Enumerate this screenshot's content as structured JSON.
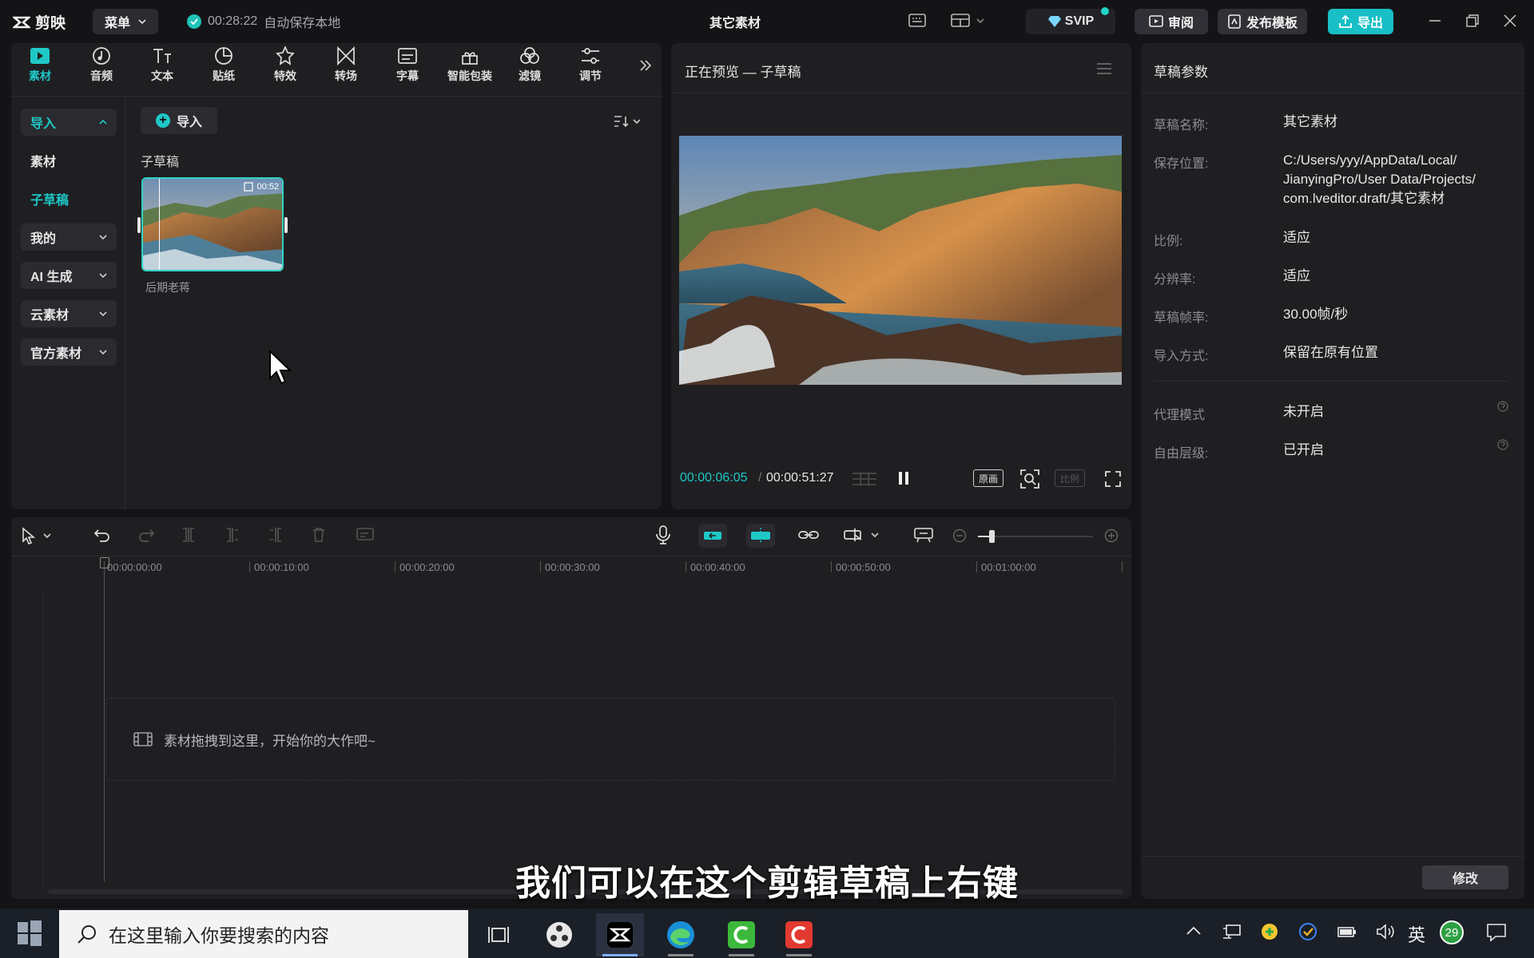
{
  "titlebar": {
    "app_name": "剪映",
    "menu_label": "菜单",
    "autosave_time": "00:28:22",
    "autosave_text": "自动保存本地",
    "project_title": "其它素材",
    "svip_label": "SVIP",
    "review_label": "审阅",
    "publish_template_label": "发布模板",
    "export_label": "导出"
  },
  "toolbar": {
    "tabs": [
      {
        "label": "素材",
        "icon": "media-icon",
        "active": true
      },
      {
        "label": "音频",
        "icon": "audio-icon"
      },
      {
        "label": "文本",
        "icon": "text-icon"
      },
      {
        "label": "贴纸",
        "icon": "sticker-icon"
      },
      {
        "label": "特效",
        "icon": "effects-icon"
      },
      {
        "label": "转场",
        "icon": "transition-icon"
      },
      {
        "label": "字幕",
        "icon": "caption-icon"
      },
      {
        "label": "智能包装",
        "icon": "smart-pack-icon"
      },
      {
        "label": "滤镜",
        "icon": "filter-icon"
      },
      {
        "label": "调节",
        "icon": "adjust-icon"
      }
    ]
  },
  "sidebar": {
    "items": [
      {
        "label": "导入",
        "active": true
      },
      {
        "label": "素材"
      },
      {
        "label": "子草稿",
        "active": true
      },
      {
        "label": "我的"
      },
      {
        "label": "AI 生成"
      },
      {
        "label": "云素材"
      },
      {
        "label": "官方素材"
      }
    ]
  },
  "media": {
    "import_label": "导入",
    "section_title": "子草稿",
    "clip_name": "后期老蒋",
    "clip_duration": "00:52"
  },
  "preview": {
    "title": "正在预览 — 子草稿",
    "current_time": "00:00:06:05",
    "total_time": "00:00:51:27",
    "original_label": "原画",
    "ratio_label": "比例"
  },
  "draft_params": {
    "title": "草稿参数",
    "rows": [
      {
        "label": "草稿名称:",
        "value": "其它素材"
      },
      {
        "label": "保存位置:",
        "value_lines": [
          "C:/Users/yyy/AppData/Local/",
          "JianyingPro/User Data/Projects/",
          "com.lveditor.draft/其它素材"
        ]
      },
      {
        "label": "比例:",
        "value": "适应"
      },
      {
        "label": "分辨率:",
        "value": "适应"
      },
      {
        "label": "草稿帧率:",
        "value": "30.00帧/秒"
      },
      {
        "label": "导入方式:",
        "value": "保留在原有位置"
      },
      {
        "label": "代理模式",
        "value": "未开启"
      },
      {
        "label": "自由层级:",
        "value": "已开启"
      }
    ],
    "modify_label": "修改"
  },
  "timeline": {
    "ticks": [
      "00:00:00:00",
      "00:00:10:00",
      "00:00:20:00",
      "00:00:30:00",
      "00:00:40:00",
      "00:00:50:00",
      "00:01:00:00"
    ],
    "drop_hint": "素材拖拽到这里，开始你的大作吧~"
  },
  "subtitle_overlay": "我们可以在这个剪辑草稿上右键",
  "taskbar": {
    "search_placeholder": "在这里输入你要搜索的内容",
    "ime_label": "英",
    "notification_count": "29"
  },
  "colors": {
    "accent": "#1fc8c7",
    "panel": "#1f1f22",
    "background": "#141417"
  }
}
